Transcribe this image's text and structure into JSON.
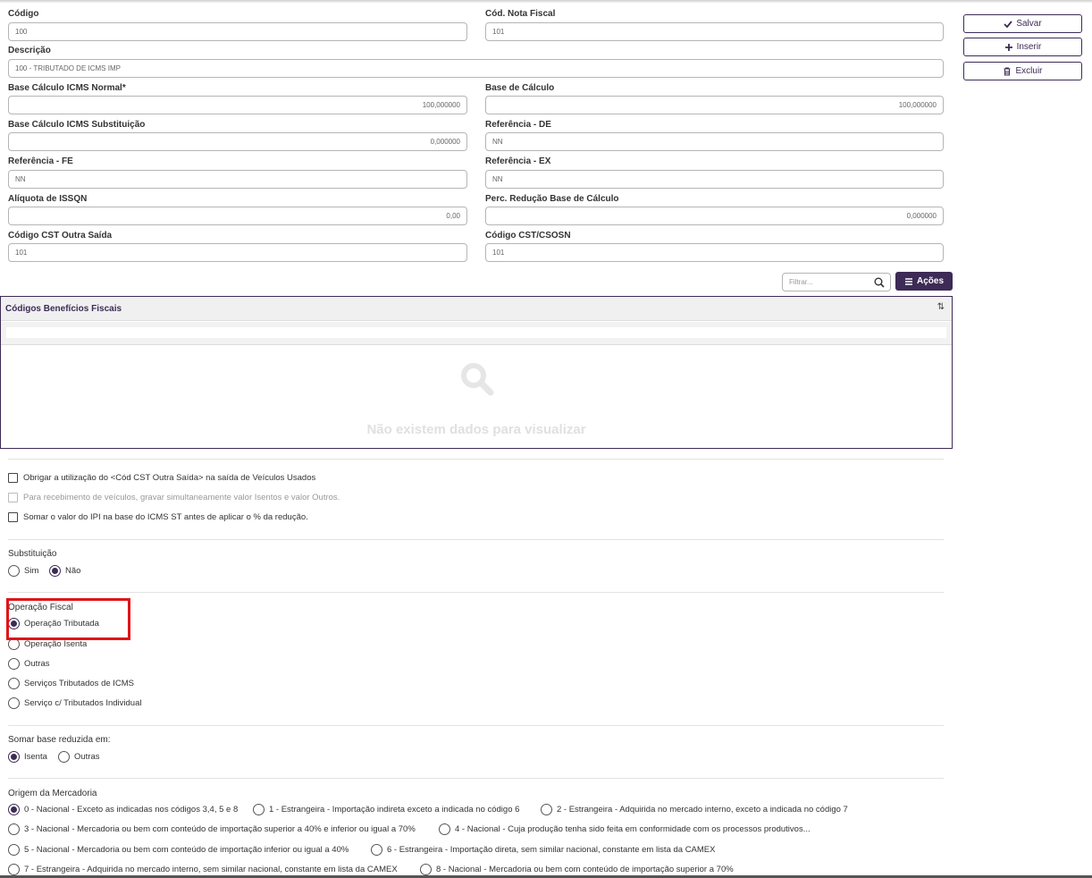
{
  "fields": {
    "codigo": {
      "label": "Código",
      "value": "100"
    },
    "cod_nota_fiscal": {
      "label": "Cód. Nota Fiscal",
      "value": "101"
    },
    "descricao": {
      "label": "Descrição",
      "value": "100 - TRIBUTADO DE ICMS IMP"
    },
    "base_calculo_icms_normal": {
      "label": "Base Cálculo ICMS Normal*",
      "value": "100,000000"
    },
    "base_de_calculo": {
      "label": "Base de Cálculo",
      "value": "100,000000"
    },
    "base_calculo_icms_subst": {
      "label": "Base Cálculo ICMS Substituição",
      "value": "0,000000"
    },
    "referencia_de": {
      "label": "Referência - DE",
      "value": "NN"
    },
    "referencia_fe": {
      "label": "Referência - FE",
      "value": "NN"
    },
    "referencia_ex": {
      "label": "Referência - EX",
      "value": "NN"
    },
    "aliquota_issqn": {
      "label": "Alíquota de ISSQN",
      "value": "0,00"
    },
    "perc_reducao_base": {
      "label": "Perc. Redução Base de Cálculo",
      "value": "0,000000"
    },
    "codigo_cst_outra_saida": {
      "label": "Código CST Outra Saída",
      "value": "101"
    },
    "codigo_cst_csosn": {
      "label": "Código CST/CSOSN",
      "value": "101"
    }
  },
  "actions": {
    "salvar": "Salvar",
    "inserir": "Inserir",
    "excluir": "Excluir"
  },
  "grid": {
    "filter_placeholder": "Filtrar...",
    "acoes_label": "Ações",
    "title": "Códigos Benefícios Fiscais",
    "sort_icon": "⇅",
    "empty_text": "Não existem dados para visualizar"
  },
  "checkboxes": [
    {
      "label": "Obrigar a utilização do <Cód CST Outra Saída> na saída de Veículos Usados",
      "checked": false,
      "disabled": false
    },
    {
      "label": "Para recebimento de veículos, gravar simultaneamente valor Isentos e valor Outros.",
      "checked": false,
      "disabled": true
    },
    {
      "label": "Somar o valor do IPI na base do ICMS ST antes de aplicar o % da redução.",
      "checked": false,
      "disabled": false
    }
  ],
  "substituicao": {
    "title": "Substituição",
    "options": [
      {
        "label": "Sim",
        "selected": false
      },
      {
        "label": "Não",
        "selected": true
      }
    ]
  },
  "operacao_fiscal": {
    "title": "Operação Fiscal",
    "options": [
      {
        "label": "Operação Tributada",
        "selected": true
      },
      {
        "label": "Operação Isenta",
        "selected": false
      },
      {
        "label": "Outras",
        "selected": false
      },
      {
        "label": "Serviços Tributados de ICMS",
        "selected": false
      },
      {
        "label": "Serviço c/ Tributados Individual",
        "selected": false
      }
    ]
  },
  "somar_base": {
    "title": "Somar base reduzida em:",
    "options": [
      {
        "label": "Isenta",
        "selected": true
      },
      {
        "label": "Outras",
        "selected": false
      }
    ]
  },
  "origem": {
    "title": "Origem da Mercadoria",
    "options": [
      {
        "label": "0 - Nacional - Exceto as indicadas nos códigos 3,4, 5 e 8",
        "selected": true
      },
      {
        "label": "1 - Estrangeira - Importação indireta exceto a indicada no código 6",
        "selected": false
      },
      {
        "label": "2 - Estrangeira - Adquirida no mercado interno, exceto a indicada no código 7",
        "selected": false
      },
      {
        "label": "3 - Nacional - Mercadoria ou bem com conteúdo de importação superior a 40% e inferior ou igual a 70%",
        "selected": false
      },
      {
        "label": "4 - Nacional - Cuja produção tenha sido feita em conformidade com os processos produtivos...",
        "selected": false
      },
      {
        "label": "5 - Nacional - Mercadoria ou bem com conteúdo de importação inferior ou igual a 40%",
        "selected": false
      },
      {
        "label": "6 - Estrangeira - Importação direta, sem similar nacional, constante em lista da CAMEX",
        "selected": false
      },
      {
        "label": "7 - Estrangeira - Adquirida no mercado interno, sem similar nacional, constante em lista da CAMEX",
        "selected": false
      },
      {
        "label": "8 - Nacional - Mercadoria ou bem com conteúdo de importação superior a 70%",
        "selected": false
      }
    ]
  },
  "colors": {
    "accent": "#3d2b56",
    "highlight": "#e0141a"
  }
}
